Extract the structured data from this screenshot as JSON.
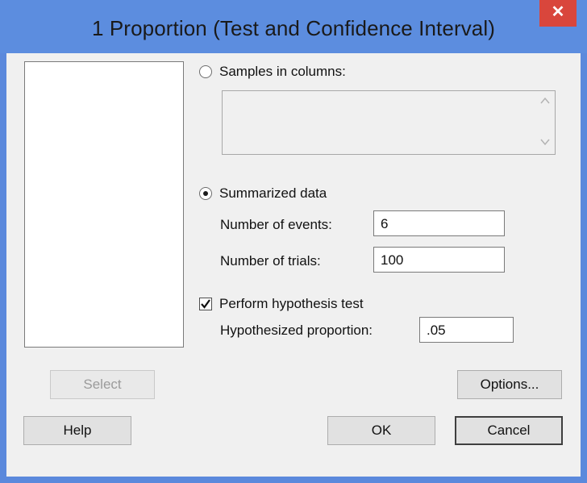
{
  "window": {
    "title": "1 Proportion (Test and Confidence Interval)",
    "close_glyph": "✕"
  },
  "samples": {
    "label": "Samples in columns:",
    "selected": false
  },
  "summarized": {
    "label": "Summarized data",
    "selected": true,
    "events_label": "Number of events:",
    "events_value": "6",
    "trials_label": "Number of trials:",
    "trials_value": "100"
  },
  "hypothesis": {
    "label": "Perform hypothesis test",
    "checked": true,
    "proportion_label": "Hypothesized proportion:",
    "proportion_value": ".05"
  },
  "buttons": {
    "select": "Select",
    "options": "Options...",
    "help": "Help",
    "ok": "OK",
    "cancel": "Cancel"
  },
  "scroll_icons": {
    "up": "chevron-up-icon",
    "down": "chevron-down-icon"
  }
}
